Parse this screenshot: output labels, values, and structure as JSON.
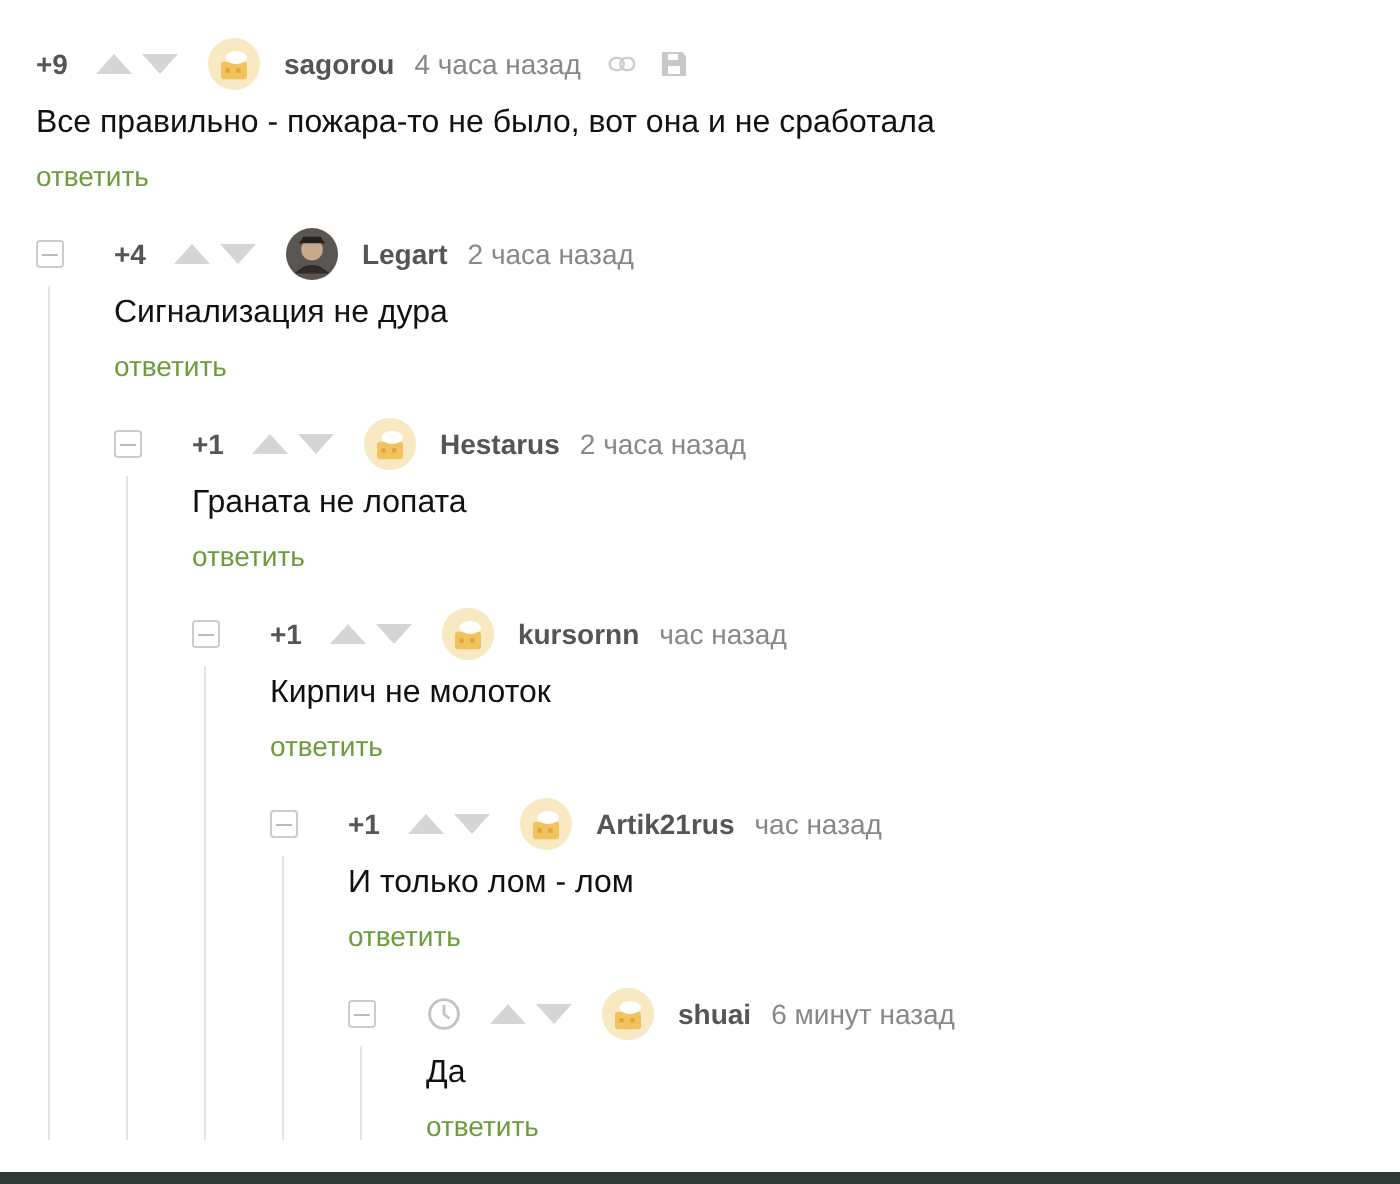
{
  "comment": {
    "score": "+9",
    "author": "sagorou",
    "avatar": {
      "kind": "default"
    },
    "time": "4 часа назад",
    "text": "Все правильно - пожара-то не было, вот она и не сработала",
    "reply": "ответить",
    "collapsible": false,
    "tools": true,
    "children": [
      {
        "score": "+4",
        "author": "Legart",
        "avatar": {
          "kind": "photo"
        },
        "time": "2 часа назад",
        "text": "Сигнализация не дура",
        "reply": "ответить",
        "collapsible": true,
        "children": [
          {
            "score": "+1",
            "author": "Hestarus",
            "avatar": {
              "kind": "default"
            },
            "time": "2 часа назад",
            "text": "Граната не лопата",
            "reply": "ответить",
            "collapsible": true,
            "children": [
              {
                "score": "+1",
                "author": "kursornn",
                "avatar": {
                  "kind": "default"
                },
                "time": "час назад",
                "text": "Кирпич не молоток",
                "reply": "ответить",
                "collapsible": true,
                "children": [
                  {
                    "score": "+1",
                    "author": "Artik21rus",
                    "avatar": {
                      "kind": "default"
                    },
                    "time": "час назад",
                    "text": "И только лом - лом",
                    "reply": "ответить",
                    "collapsible": true,
                    "children": [
                      {
                        "author": "shuai",
                        "avatar": {
                          "kind": "default"
                        },
                        "time": "6 минут назад",
                        "text": "Да",
                        "reply": "ответить",
                        "collapsible": true
                      }
                    ]
                  }
                ]
              }
            ]
          }
        ]
      }
    ]
  }
}
